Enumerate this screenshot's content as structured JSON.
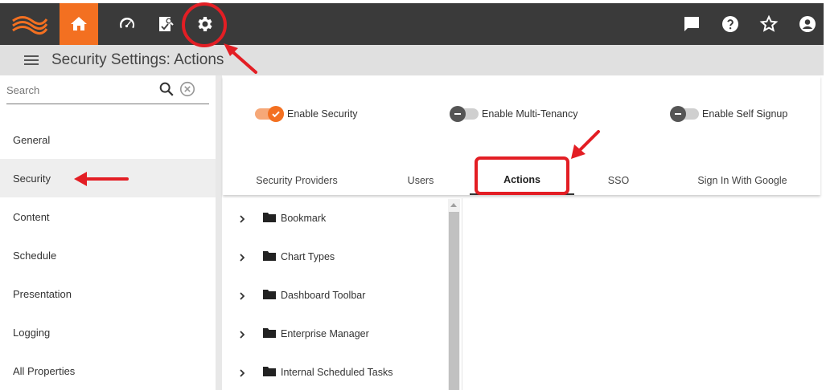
{
  "window": {
    "title": "Security Settings: Actions"
  },
  "topbar": {
    "left_icons": [
      "home-icon",
      "dashboard-gauge-icon",
      "report-edit-icon",
      "gear-icon"
    ],
    "right_icons": [
      "chat-icon",
      "help-icon",
      "star-icon",
      "account-icon"
    ],
    "accent_color": "#f37021"
  },
  "sidebar": {
    "search": {
      "placeholder": "Search",
      "value": ""
    },
    "items": [
      {
        "label": "General"
      },
      {
        "label": "Security"
      },
      {
        "label": "Content"
      },
      {
        "label": "Schedule"
      },
      {
        "label": "Presentation"
      },
      {
        "label": "Logging"
      },
      {
        "label": "All Properties"
      }
    ],
    "selected": "Security"
  },
  "toggles": [
    {
      "label": "Enable Security",
      "on": true
    },
    {
      "label": "Enable Multi-Tenancy",
      "on": false
    },
    {
      "label": "Enable Self Signup",
      "on": false
    }
  ],
  "tabs": [
    {
      "label": "Security Providers"
    },
    {
      "label": "Users"
    },
    {
      "label": "Actions"
    },
    {
      "label": "SSO"
    },
    {
      "label": "Sign In With Google"
    }
  ],
  "active_tab": "Actions",
  "tree": [
    {
      "label": "Bookmark"
    },
    {
      "label": "Chart Types"
    },
    {
      "label": "Dashboard Toolbar"
    },
    {
      "label": "Enterprise Manager"
    },
    {
      "label": "Internal Scheduled Tasks"
    }
  ],
  "annotation_color": "#e31e24"
}
